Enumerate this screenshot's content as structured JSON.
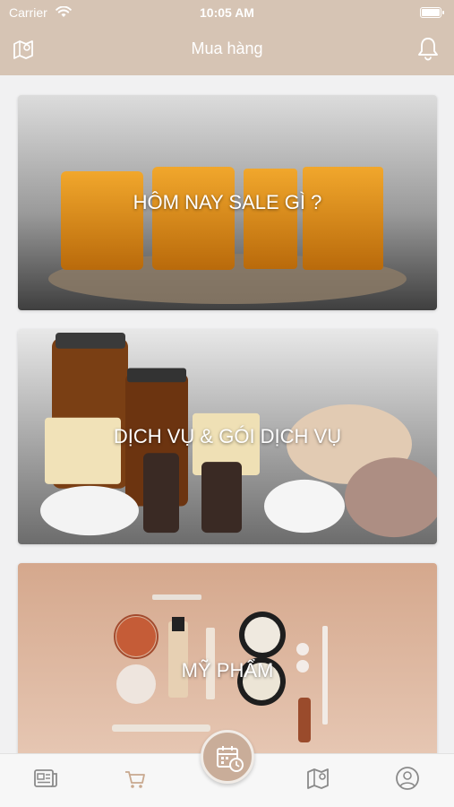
{
  "status_bar": {
    "carrier": "Carrier",
    "time": "10:05 AM"
  },
  "header": {
    "title": "Mua hàng",
    "left_icon": "map-icon",
    "right_icon": "bell-icon"
  },
  "cards": [
    {
      "label": "HÔM NAY SALE GÌ ?",
      "image": "sale-image"
    },
    {
      "label": "DỊCH VỤ & GÓI DỊCH VỤ",
      "image": "spa-image"
    },
    {
      "label": "MỸ PHẨM",
      "image": "cosmetics-image"
    }
  ],
  "tab_bar": {
    "items": [
      {
        "icon": "news-icon",
        "active": false
      },
      {
        "icon": "cart-icon",
        "active": true
      },
      {
        "icon": "calendar-clock-icon",
        "active": false
      },
      {
        "icon": "map-icon",
        "active": false
      },
      {
        "icon": "user-icon",
        "active": false
      }
    ]
  },
  "colors": {
    "header_bg": "#d6c4b4",
    "accent": "#c9ad99",
    "cart_active": "#c9a98f"
  }
}
